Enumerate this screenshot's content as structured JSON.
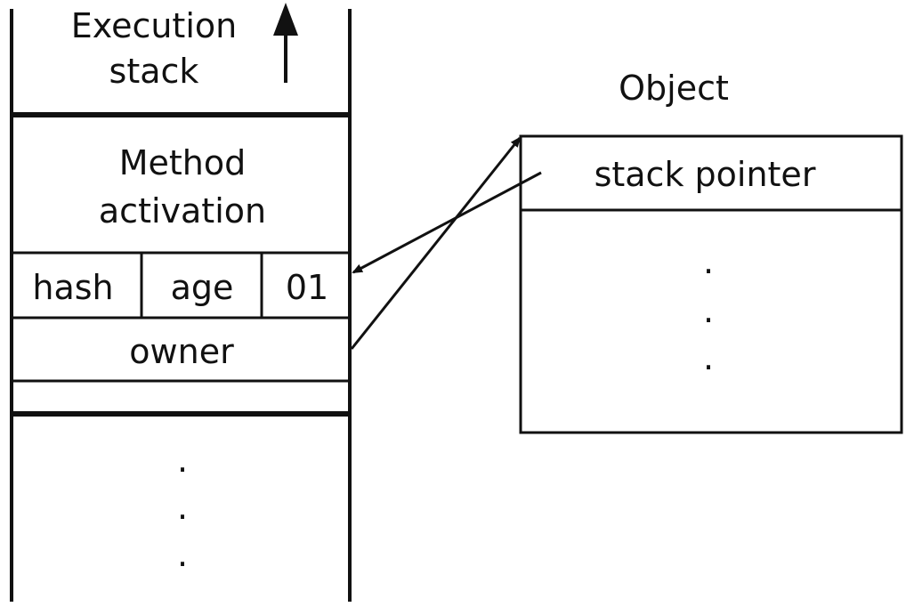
{
  "execution_stack": {
    "title_line1": "Execution",
    "title_line2": "stack",
    "growth_direction": "up"
  },
  "method_activation": {
    "line1": "Method",
    "line2": "activation"
  },
  "lock_record": {
    "fields": [
      "hash",
      "age",
      "01"
    ],
    "owner_label": "owner"
  },
  "stack_continuation": [
    "·",
    "·",
    "·"
  ],
  "object": {
    "title": "Object",
    "header_field": "stack pointer",
    "continuation": [
      "·",
      "·",
      "·"
    ]
  },
  "arrows": [
    {
      "from": "lock_record.owner",
      "to": "object"
    },
    {
      "from": "object.stack_pointer",
      "to": "lock_record.mark_word"
    }
  ],
  "colors": {
    "stroke": "#111111",
    "background": "#ffffff"
  }
}
